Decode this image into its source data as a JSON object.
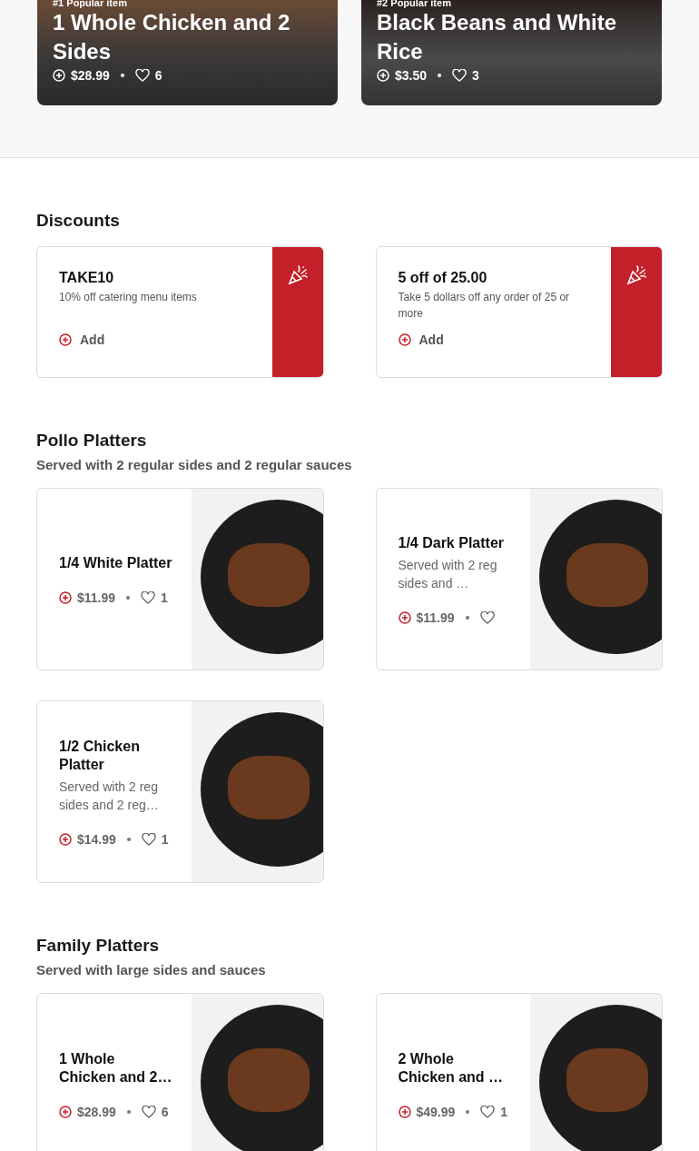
{
  "popular": [
    {
      "rank": "#1 Popular item",
      "name": "1 Whole Chicken and 2 Sides",
      "price": "$28.99",
      "likes": "6"
    },
    {
      "rank": "#2 Popular item",
      "name": "Black Beans and White Rice",
      "price": "$3.50",
      "likes": "3"
    }
  ],
  "discounts": {
    "title": "Discounts",
    "items": [
      {
        "code": "TAKE10",
        "description": "10% off catering menu items",
        "action": "Add"
      },
      {
        "code": "5 off of 25.00",
        "description": "Take 5 dollars off any order of 25 or more",
        "action": "Add"
      }
    ]
  },
  "sections": [
    {
      "title": "Pollo Platters",
      "subtitle": "Served with 2 regular sides and 2 regular sauces",
      "items": [
        {
          "name": "1/4 White Platter",
          "price": "$11.99",
          "likes": "1"
        },
        {
          "name": "1/4 Dark Platter",
          "description": "Served with 2 reg sides and …",
          "price": "$11.99"
        },
        {
          "name": "1/2 Chicken Platter",
          "description": "Served with 2 reg sides and 2 reg…",
          "price": "$14.99",
          "likes": "1"
        }
      ]
    },
    {
      "title": "Family Platters",
      "subtitle": "Served with large sides and sauces",
      "items": [
        {
          "name": "1 Whole Chicken and 2…",
          "price": "$28.99",
          "likes": "6"
        },
        {
          "name": "2 Whole Chicken and …",
          "price": "$49.99",
          "likes": "1"
        }
      ]
    }
  ]
}
